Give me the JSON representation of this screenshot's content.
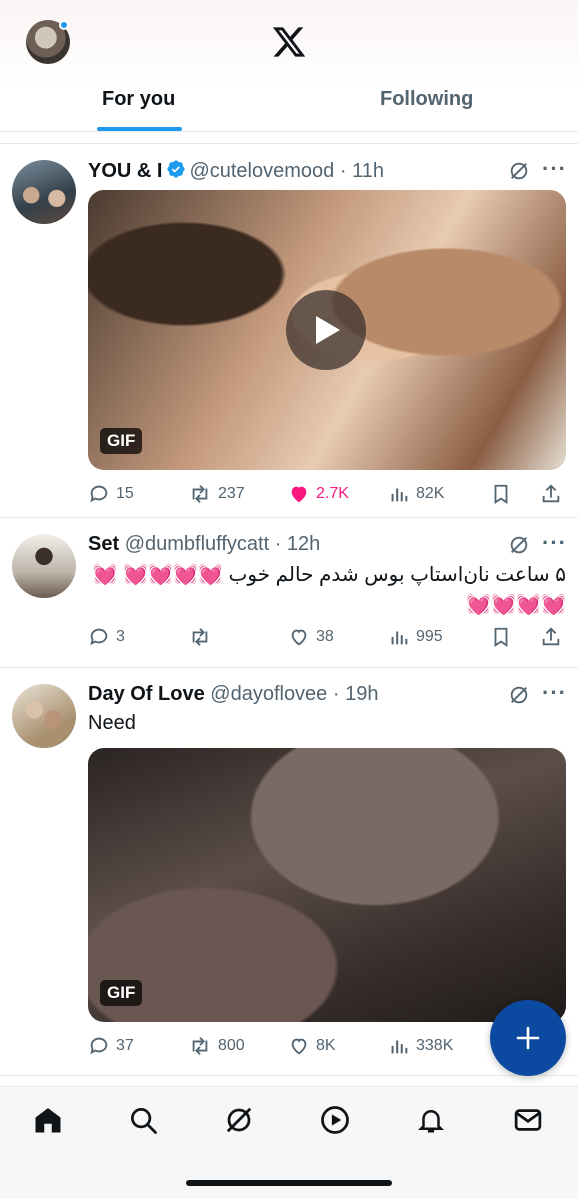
{
  "header": {
    "tabs": [
      {
        "label": "For you",
        "active": true
      },
      {
        "label": "Following",
        "active": false
      }
    ]
  },
  "posts": [
    {
      "name": "YOU & I",
      "verified": true,
      "handle": "@cutelovemood",
      "time": "11h",
      "media_type": "GIF",
      "media_label": "GIF",
      "has_play": true,
      "stats": {
        "replies": "15",
        "reposts": "237",
        "likes": "2.7K",
        "views": "82K"
      },
      "liked": true
    },
    {
      "name": "Set",
      "verified": false,
      "handle": "@dumbfluffycatt",
      "time": "12h",
      "text": "۵ ساعت نان‌استاپ بوس شدم حالم خوب 💓💓💓💓 💓💓💓💓💓",
      "stats": {
        "replies": "3",
        "reposts": "",
        "likes": "38",
        "views": "995"
      },
      "liked": false
    },
    {
      "name": "Day Of Love",
      "verified": false,
      "handle": "@dayoflovee",
      "time": "19h",
      "text": "Need",
      "media_type": "GIF",
      "media_label": "GIF",
      "stats": {
        "replies": "37",
        "reposts": "800",
        "likes": "8K",
        "views": "338K"
      },
      "liked": false
    }
  ],
  "nav": [
    "home-icon",
    "search-icon",
    "grok-icon",
    "video-icon",
    "notifications-icon",
    "messages-icon"
  ],
  "colors": {
    "accent": "#1d9bf0",
    "like": "#f91880",
    "fab": "#0b4aa0",
    "secondary_text": "#536471"
  }
}
